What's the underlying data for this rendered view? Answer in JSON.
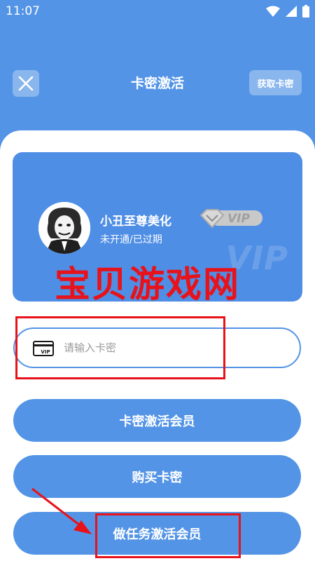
{
  "status_bar": {
    "time": "11:07"
  },
  "header": {
    "title": "卡密激活",
    "get_card_label": "获取卡密"
  },
  "vip_card": {
    "user_name": "小丑至尊美化",
    "status": "未开通/已过期",
    "badge_text": "VIP",
    "watermark": "VIP"
  },
  "overlay": {
    "watermark_text": "宝贝游戏网"
  },
  "card_input": {
    "placeholder": "请输入卡密",
    "icon_text": "VIP",
    "value": ""
  },
  "buttons": {
    "activate_label": "卡密激活会员",
    "buy_label": "购买卡密",
    "task_label": "做任务激活会员"
  },
  "colors": {
    "primary": "#5394e6",
    "annotation": "#e8121a",
    "background": "#ffffff"
  }
}
